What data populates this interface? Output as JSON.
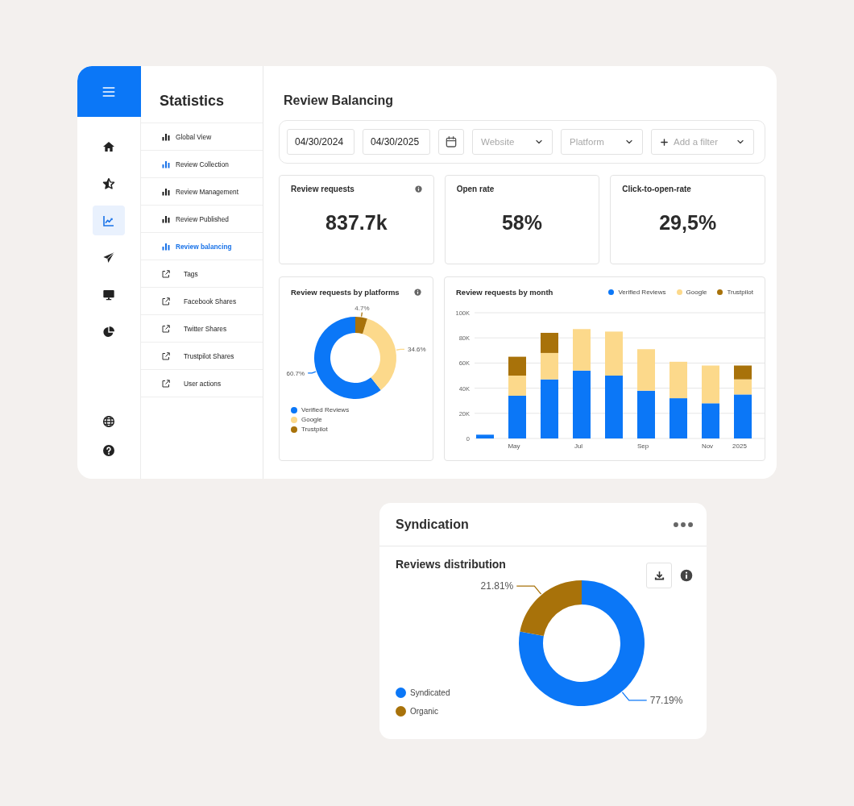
{
  "rail": {
    "items": [
      {
        "kind": "home",
        "selected": false
      },
      {
        "kind": "star",
        "selected": false
      },
      {
        "kind": "chart",
        "selected": true
      },
      {
        "kind": "send",
        "selected": false
      },
      {
        "kind": "monitor",
        "selected": false
      },
      {
        "kind": "pie",
        "selected": false
      }
    ],
    "footer_items": [
      {
        "kind": "globe",
        "selected": false
      },
      {
        "kind": "help",
        "selected": false
      }
    ]
  },
  "nav": {
    "title": "Statistics",
    "items": [
      {
        "label": "Global View",
        "kind": "report",
        "color": "#1c1c1c",
        "selected": false
      },
      {
        "label": "Review Collection",
        "kind": "report",
        "color": "#1a73e8",
        "selected": false
      },
      {
        "label": "Review Management",
        "kind": "report",
        "color": "#1c1c1c",
        "selected": false
      },
      {
        "label": "Review Published",
        "kind": "report",
        "color": "#1c1c1c",
        "selected": false
      },
      {
        "label": "Review balancing",
        "kind": "report",
        "color": "#1a73e8",
        "selected": true
      },
      {
        "label": "Tags",
        "kind": "external",
        "selected": false
      },
      {
        "label": "Facebook Shares",
        "kind": "external",
        "selected": false
      },
      {
        "label": "Twitter Shares",
        "kind": "external",
        "selected": false
      },
      {
        "label": "Trustpilot Shares",
        "kind": "external",
        "selected": false
      },
      {
        "label": "User actions",
        "kind": "external",
        "selected": false
      }
    ]
  },
  "page": {
    "title": "Review Balancing"
  },
  "filters": {
    "start_date": "04/30/2024",
    "end_date": "04/30/2025",
    "dropdowns": [
      {
        "placeholder": "Website",
        "kind": "select"
      },
      {
        "placeholder": "Platform",
        "kind": "select"
      },
      {
        "placeholder": "Add a filter",
        "kind": "add"
      }
    ]
  },
  "kpis": [
    {
      "label": "Review requests",
      "value": "837.7k",
      "info": true
    },
    {
      "label": "Open rate",
      "value": "58%"
    },
    {
      "label": "Click-to-open-rate",
      "value": "29,5%"
    }
  ],
  "platform_chart": {
    "title": "Review requests by platforms",
    "info": true,
    "chart_data": {
      "type": "donut",
      "categories": [
        "Verified Reviews",
        "Google",
        "Trustpilot"
      ],
      "values": [
        60.7,
        34.6,
        4.7
      ],
      "colors": [
        "#0b77f7",
        "#fcd98b",
        "#a8720a"
      ],
      "value_labels": [
        "60.7%",
        "34.6%",
        "4.7%"
      ]
    }
  },
  "month_chart": {
    "title": "Review requests by month",
    "chart_data": {
      "type": "bar",
      "stacked": true,
      "grid": true,
      "categories": [
        null,
        "May",
        null,
        "Jul",
        null,
        "Sep",
        null,
        "Nov",
        "2025"
      ],
      "ylim": [
        0,
        100000
      ],
      "yticks": [
        {
          "value": 0,
          "label": "0"
        },
        {
          "value": 20000,
          "label": "20K"
        },
        {
          "value": 40000,
          "label": "40K"
        },
        {
          "value": 60000,
          "label": "60K"
        },
        {
          "value": 80000,
          "label": "80K"
        },
        {
          "value": 100000,
          "label": "100K"
        }
      ],
      "series": [
        {
          "name": "Verified Reviews",
          "color": "#0b77f7",
          "values": [
            3000,
            34000,
            47000,
            54000,
            50000,
            38000,
            32000,
            28000,
            35000
          ]
        },
        {
          "name": "Google",
          "color": "#fcd98b",
          "values": [
            null,
            16000,
            21000,
            33000,
            35000,
            33000,
            29000,
            30000,
            12000
          ]
        },
        {
          "name": "Trustpilot",
          "color": "#a8720a",
          "values": [
            null,
            15000,
            16000,
            null,
            null,
            null,
            null,
            null,
            11000
          ]
        }
      ]
    }
  },
  "syndication": {
    "title": "Syndication",
    "subtitle": "Reviews distribution",
    "chart_data": {
      "type": "donut",
      "categories": [
        "Syndicated",
        "Organic"
      ],
      "values": [
        77.19,
        21.81
      ],
      "colors": [
        "#0b77f7",
        "#a8720a"
      ],
      "value_labels": [
        "77.19%",
        "21.81%"
      ]
    }
  }
}
